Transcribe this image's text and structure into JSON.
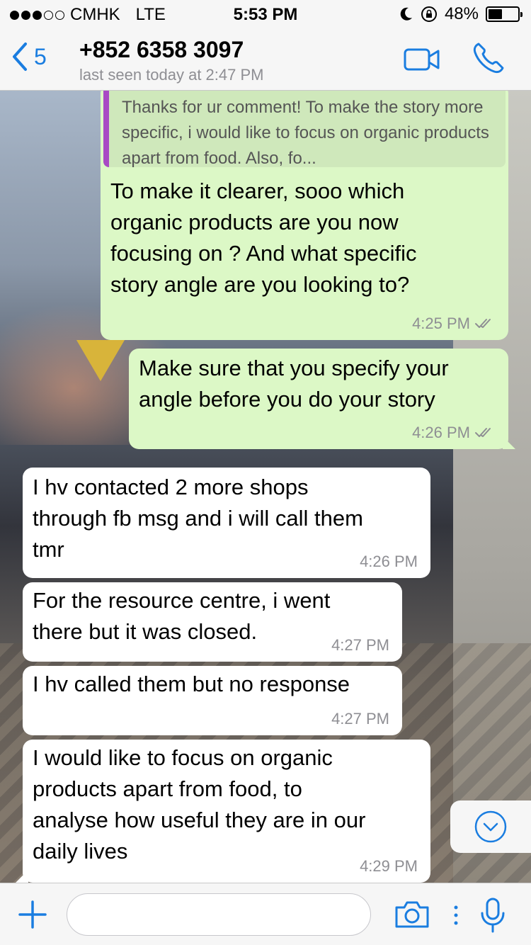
{
  "status_bar": {
    "carrier": "CMHK",
    "network": "LTE",
    "time": "5:53 PM",
    "battery": "48%",
    "battery_level": 0.48
  },
  "header": {
    "back_count": "5",
    "contact_name": "+852 6358 3097",
    "last_seen": "last seen today at 2:47 PM"
  },
  "messages": [
    {
      "direction": "out",
      "quoted_text": "Thanks for ur comment! To make the story more specific, i would like to focus on organic products apart from food. Also, fo...",
      "text": "To make it clearer, sooo which\norganic products are you now\nfocusing on ? And what specific\nstory angle are you looking to?",
      "time": "4:25 PM",
      "read": true
    },
    {
      "direction": "out",
      "text": "Make sure that you specify your\nangle before you do your story",
      "time": "4:26 PM",
      "read": true
    },
    {
      "direction": "in",
      "text": "I hv contacted 2 more shops\nthrough fb msg and i will call them\ntmr",
      "time": "4:26 PM"
    },
    {
      "direction": "in",
      "text": "For the resource centre, i went\nthere but it was closed.",
      "time": "4:27 PM"
    },
    {
      "direction": "in",
      "text": "I hv called them but no response",
      "time": "4:27 PM"
    },
    {
      "direction": "in",
      "text": "I would like to focus on organic\nproducts apart from food, to\nanalyse how useful they are in our\ndaily lives",
      "time": "4:29 PM"
    }
  ],
  "input": {
    "placeholder": "",
    "value": ""
  },
  "colors": {
    "accent": "#1a7de0",
    "outgoing_bubble": "#dcf8c6",
    "incoming_bubble": "#ffffff",
    "quote_bar": "#a84ac4",
    "read_ticks": "#8e8e93"
  },
  "icons": {
    "back": "chevron-left-icon",
    "video": "video-camera-icon",
    "call": "phone-icon",
    "add": "plus-icon",
    "camera": "camera-icon",
    "mic": "microphone-icon",
    "scroll": "chevron-down-circle-icon"
  }
}
